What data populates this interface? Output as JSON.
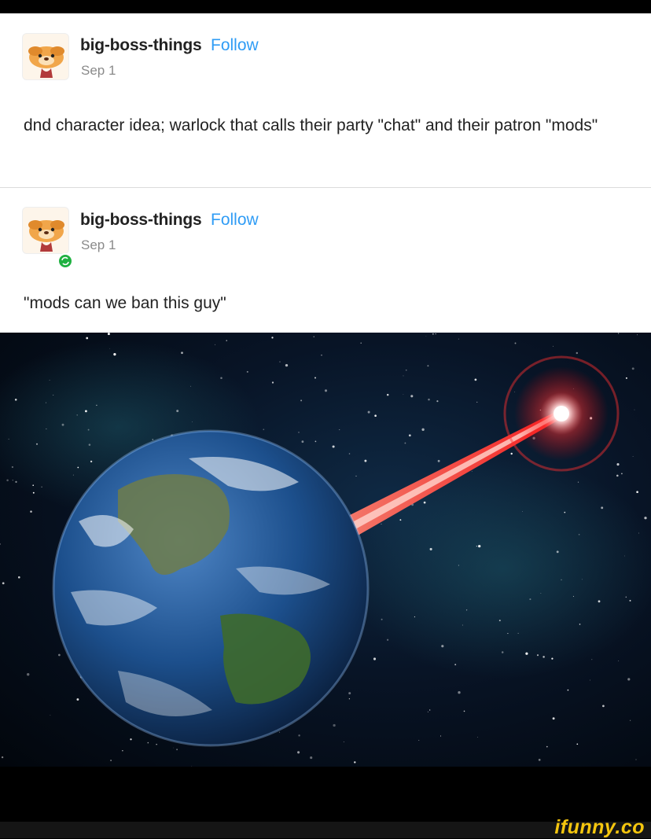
{
  "posts": [
    {
      "username": "big-boss-things",
      "follow_label": "Follow",
      "date": "Sep 1",
      "text": "dnd character idea; warlock that calls their party \"chat\" and their patron \"mods\"",
      "avatar_icon": "dog-avatar-icon"
    },
    {
      "username": "big-boss-things",
      "follow_label": "Follow",
      "date": "Sep 1",
      "text": "\"mods can we ban this guy\"",
      "avatar_icon": "dog-avatar-icon",
      "badge_icon": "reblog-badge-icon"
    }
  ],
  "image": {
    "subject": "earth-hit-by-red-laser"
  },
  "watermark": "ifunny.co",
  "colors": {
    "follow": "#2f9cf5",
    "badge": "#1fb141",
    "watermark": "#f5c60e",
    "laser": "#ff2a2a"
  }
}
